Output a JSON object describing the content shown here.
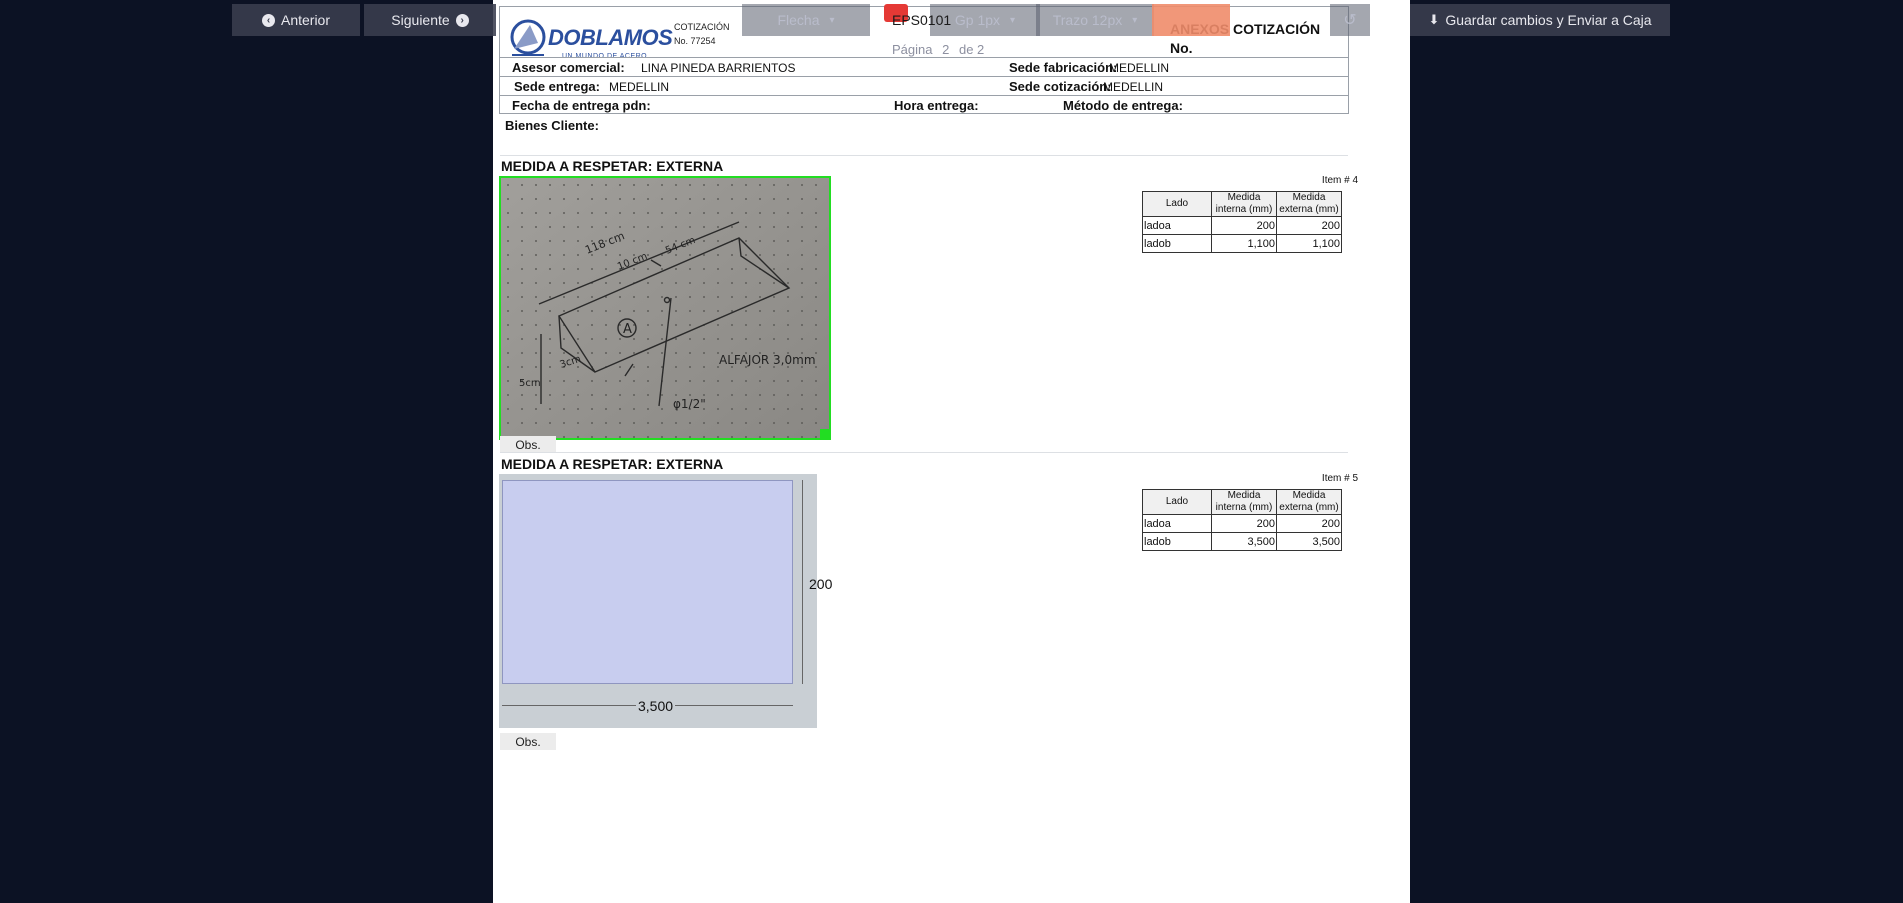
{
  "toolbar": {
    "anterior_label": "Anterior",
    "siguiente_label": "Siguiente",
    "flecha_label": "Flecha",
    "grip_label": "Gp 1px",
    "trazo_label": "Trazo 12px",
    "code_label": "EPS0101",
    "page_prefix": "Página",
    "page_current": "2",
    "page_of": "de 2",
    "save_label": "Guardar cambios y Enviar a Caja"
  },
  "header": {
    "logo_text": "DOBLAMOS",
    "logo_tagline": "UN MUNDO DE ACERO",
    "cotizacion_label": "COTIZACIÓN",
    "cotizacion_number": "No. 77254",
    "annex_title": "ANEXOS COTIZACIÓN",
    "annex_no": "No.",
    "asesor_label": "Asesor comercial:",
    "asesor_value": "LINA PINEDA BARRIENTOS",
    "sede_fab_label": "Sede fabricación:",
    "sede_fab_value": "MEDELLIN",
    "sede_entrega_label": "Sede entrega:",
    "sede_entrega_value": "MEDELLIN",
    "sede_cot_label": "Sede cotización:",
    "sede_cot_value": "MEDELLIN",
    "fecha_label": "Fecha de entrega pdn:",
    "hora_label": "Hora entrega:",
    "metodo_label": "Método de entrega:"
  },
  "bienes_label": "Bienes Cliente:",
  "sections": [
    {
      "title": "MEDIDA A RESPETAR: EXTERNA",
      "obs_label": "Obs.",
      "item_caption": "Item # 4",
      "sketch": {
        "label_118": "118 cm",
        "label_10": "10 cm",
        "label_54": "54 cm",
        "label_a": "A",
        "label_3": "3cm",
        "label_5": "5cm",
        "label_material": "ALFAJOR 3,0mm",
        "label_phi": "φ1/2\""
      },
      "table": {
        "headers": [
          "Lado",
          "Medida interna (mm)",
          "Medida externa (mm)"
        ],
        "rows": [
          [
            "ladoa",
            "200",
            "200"
          ],
          [
            "ladob",
            "1,100",
            "1,100"
          ]
        ]
      }
    },
    {
      "title": "MEDIDA A RESPETAR: EXTERNA",
      "obs_label": "Obs.",
      "item_caption": "Item # 5",
      "drawing": {
        "width_label": "3,500",
        "height_label": "200"
      },
      "table": {
        "headers": [
          "Lado",
          "Medida interna (mm)",
          "Medida externa (mm)"
        ],
        "rows": [
          [
            "ladoa",
            "200",
            "200"
          ],
          [
            "ladob",
            "3,500",
            "3,500"
          ]
        ]
      }
    }
  ],
  "colors": {
    "background": "#0c1224",
    "selection_green": "#22dd22",
    "rect_fill": "#c8cdef",
    "accent_orange": "#f08c6a",
    "logo_blue": "#2b4f9e"
  }
}
